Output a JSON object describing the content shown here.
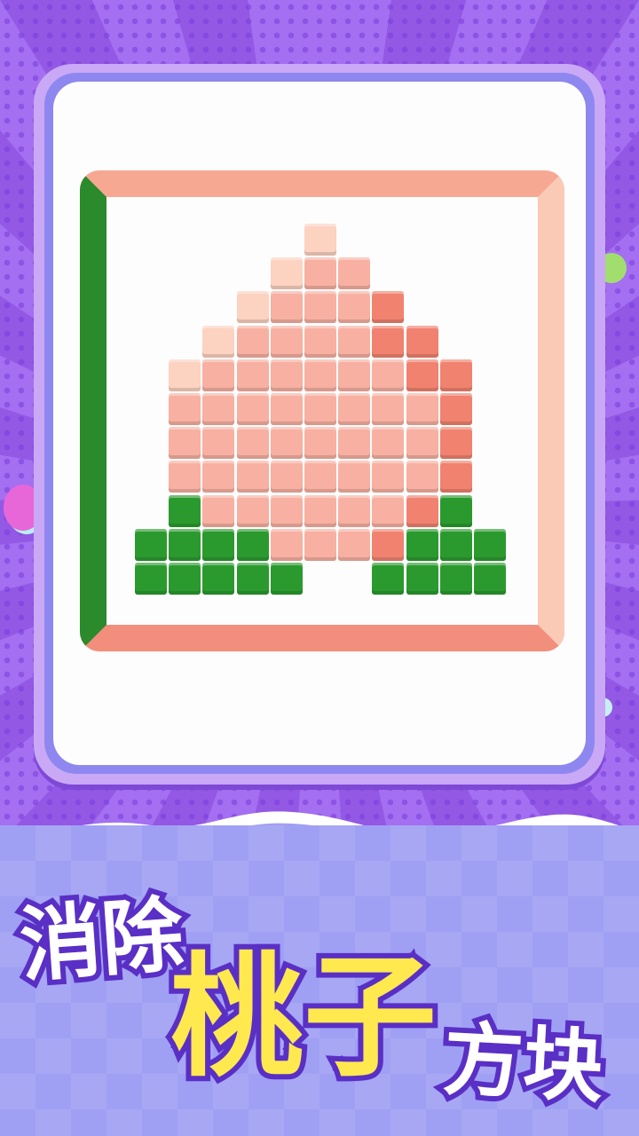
{
  "title": {
    "word1": "消除",
    "word2": "桃子",
    "word3": "方块"
  },
  "colors": {
    "background": "#9b63e8",
    "title_primary": "#ffffff",
    "title_highlight": "#ffe94e",
    "title_outline": "#5a2fc5",
    "frame_pink": "#f6a893",
    "frame_green": "#2b8a2b"
  },
  "puzzle": {
    "grid_columns": 11,
    "grid_rows": 11,
    "palette": {
      "1": "#fcd2c0",
      "2": "#f7b0a1",
      "3": "#f0826f",
      "4": "#2b9a2e"
    },
    "rows": [
      "0000010000",
      "00001220000",
      "00012223000",
      "00122223300",
      "01222222330",
      "02222222230",
      "02222222230",
      "02222222230",
      "04222222340",
      "44442223444",
      "44444004444"
    ]
  },
  "decorations": {
    "bubble_icons": [
      "pink-bubble",
      "purple-bubble",
      "green-bubble",
      "magenta-bubble",
      "lavender-bubble",
      "cyan-bubble"
    ]
  }
}
